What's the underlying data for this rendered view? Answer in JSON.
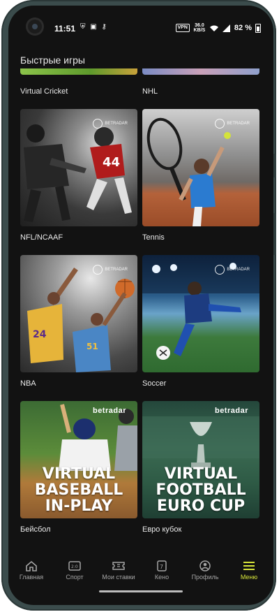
{
  "status": {
    "time": "11:51",
    "left_icons": "⛨ ▣ ⚷",
    "vpn": "VPN",
    "network_line1": "36.0",
    "network_line2": "KB/S",
    "battery": "82 %"
  },
  "header": {
    "title": "Быстрые игры"
  },
  "partial_row": {
    "left_label": "Virtual Cricket",
    "right_label": "NHL"
  },
  "games": [
    {
      "label": "NFL/NCAAF",
      "brand": "BETRADAR"
    },
    {
      "label": "Tennis",
      "brand": "BETRADAR"
    },
    {
      "label": "NBA",
      "brand": "BETRADAR"
    },
    {
      "label": "Soccer",
      "brand": "BETRADAR"
    },
    {
      "label": "Бейсбол",
      "brand": "betradar",
      "banner": [
        "VIRTUAL",
        "BASEBALL",
        "IN-PLAY"
      ]
    },
    {
      "label": "Евро кубок",
      "brand": "betradar",
      "banner": [
        "VIRTUAL",
        "FOOTBALL",
        "EURO CUP"
      ]
    }
  ],
  "navbar": {
    "items": [
      {
        "label": "Главная",
        "icon": "home-icon"
      },
      {
        "label": "Спорт",
        "icon": "scoreboard-icon"
      },
      {
        "label": "Мои ставки",
        "icon": "ticket-icon"
      },
      {
        "label": "Кено",
        "icon": "keno-icon"
      },
      {
        "label": "Профиль",
        "icon": "profile-icon"
      },
      {
        "label": "Меню",
        "icon": "menu-icon"
      }
    ],
    "active_color": "#d8e63a",
    "inactive_color": "#a5a5a5"
  }
}
